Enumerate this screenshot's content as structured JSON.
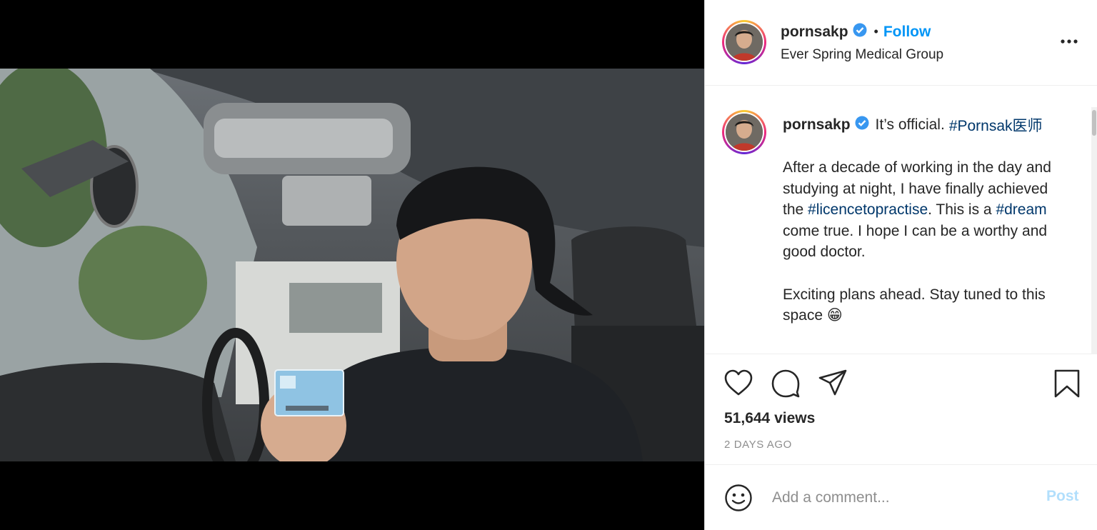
{
  "post": {
    "username": "pornsakp",
    "follow_label": "Follow",
    "separator": "•",
    "location": "Ever Spring Medical Group",
    "caption": {
      "head_text": "It’s official.",
      "head_tag": "#Pornsak医师",
      "p1_a": "After a decade of working in the day and studying at night, I have finally achieved the ",
      "p1_tag1": "#licencetopractise",
      "p1_b": ". This is a ",
      "p1_tag2": "#dream",
      "p1_c": " come true. I hope I can be a worthy and good doctor.",
      "p2": "Exciting plans ahead. Stay tuned to this space 😁"
    },
    "views": "51,644 views",
    "date": "2 DAYS AGO"
  },
  "comment": {
    "placeholder": "Add a comment...",
    "post_label": "Post"
  },
  "icons": {
    "verified": "verified-badge-icon",
    "more": "more-options-icon",
    "like": "heart-icon",
    "comment": "comment-bubble-icon",
    "share": "paper-plane-icon",
    "save": "bookmark-icon",
    "emoji": "smiley-icon",
    "mute": "speaker-icon"
  },
  "colors": {
    "link": "#00376b",
    "follow": "#0095f6",
    "verified": "#3897f0",
    "muted_text": "#8e8e8e",
    "post_disabled": "#b2dffc"
  }
}
